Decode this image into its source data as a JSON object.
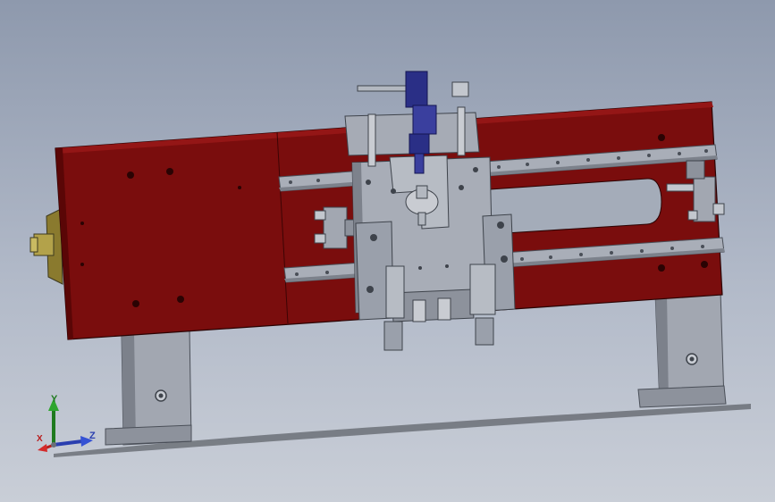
{
  "colors": {
    "background_top": "#8e99ad",
    "background_bottom": "#c9ced7",
    "base_plate": "#7a0d0d",
    "base_plate_edge": "#5a0606",
    "steel": "#9aa0ab",
    "steel_dark": "#6f7580",
    "cylinder_blue": "#2a2f86"
  },
  "view_triad": {
    "y_label": "Y",
    "z_label": "Z",
    "x_label": "X",
    "y_color": "#1f7a1f",
    "z_color": "#2a3fb0",
    "x_color": "#b81c1c"
  }
}
